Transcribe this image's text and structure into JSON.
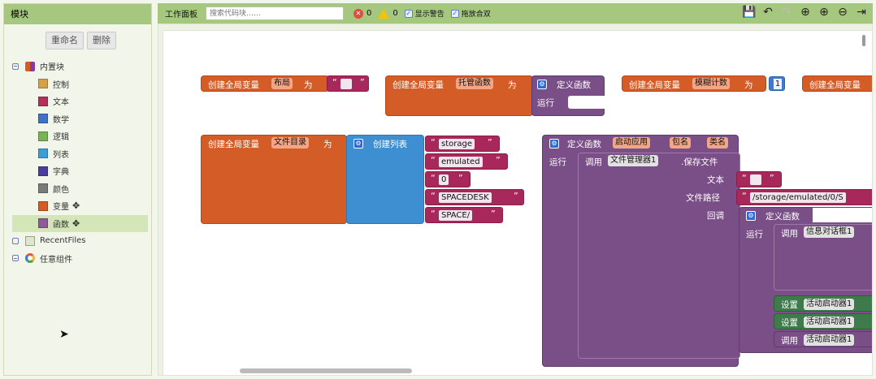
{
  "left_panel": {
    "title": "模块",
    "rename_button": "重命名",
    "delete_button": "删除",
    "tree": {
      "builtin_label": "内置块",
      "categories": [
        {
          "label": "控制",
          "color": "#d2a04b"
        },
        {
          "label": "文本",
          "color": "#b3305a"
        },
        {
          "label": "数学",
          "color": "#3f72c5"
        },
        {
          "label": "逻辑",
          "color": "#7ab352"
        },
        {
          "label": "列表",
          "color": "#3e9ed4"
        },
        {
          "label": "字典",
          "color": "#4b3c9e"
        },
        {
          "label": "颜色",
          "color": "#7a7a7a"
        },
        {
          "label": "变量",
          "color": "#d35c27"
        },
        {
          "label": "函数",
          "color": "#8e5b98"
        }
      ],
      "recent_label": "RecentFiles",
      "any_label": "任意组件"
    }
  },
  "toolbar": {
    "title": "工作面板",
    "search_placeholder": "搜索代码块……",
    "error_count": "0",
    "warning_count": "0",
    "show_warnings": "显示警告",
    "drag_align": "拖放合双"
  },
  "blocks": {
    "var1": {
      "prefix": "创建全局变量",
      "name": "布局",
      "as": "为"
    },
    "var2": {
      "prefix": "创建全局变量",
      "name": "托管函数",
      "as": "为",
      "def": "定义函数",
      "run": "运行"
    },
    "var3": {
      "prefix": "创建全局变量",
      "name": "模糊计数",
      "as": "为",
      "value": "1"
    },
    "var4": {
      "prefix": "创建全局变量"
    },
    "var5": {
      "prefix": "创建全局变量",
      "name": "文件目录",
      "as": "为",
      "list": "创建列表",
      "items": [
        "storage",
        "emulated",
        "0",
        "SPACEDESK",
        "SPACE/"
      ]
    },
    "proc": {
      "def": "定义函数",
      "name": "启动应用",
      "param1": "包名",
      "param2": "类名",
      "run": "运行",
      "call": "调用",
      "component": "文件管理器1",
      "method": ".保存文件",
      "text_label": "文本",
      "path_label": "文件路径",
      "path_value": "/storage/emulated/0/S",
      "callback_label": "回调",
      "inner_def": "定义函数",
      "inner_run": "运行",
      "inner_call": "调用",
      "dialog": "信息对话框1",
      "set1": "设置",
      "starter1": "活动启动器1",
      "set2": "设置",
      "starter2": "活动启动器1",
      "call2": "调用",
      "starter3": "活动启动器1"
    }
  }
}
